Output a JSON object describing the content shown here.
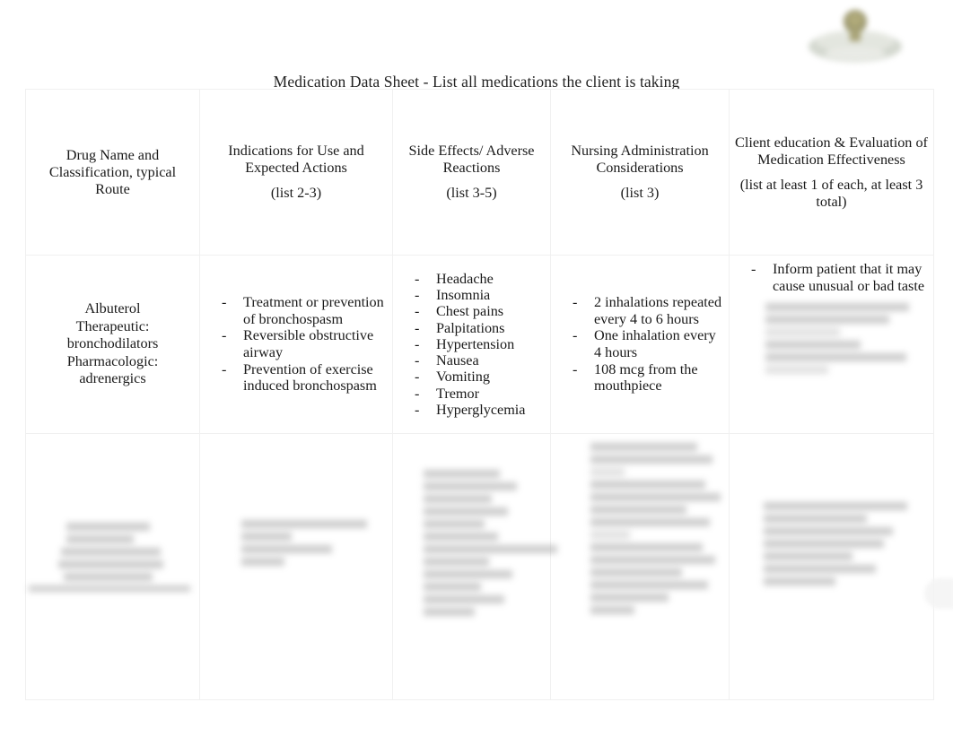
{
  "document": {
    "title": "Medication Data Sheet - List all medications the client is taking",
    "logo_icon": "school-crest-logo",
    "logo_colors": {
      "crest": "#8a8555",
      "banner": "#c9cec4"
    }
  },
  "table": {
    "columns": [
      {
        "id": "drug-name",
        "header_main": "Drug Name and Classification, typical Route",
        "header_sub": ""
      },
      {
        "id": "indications",
        "header_main": "Indications for Use and Expected Actions",
        "header_sub": "(list 2-3)"
      },
      {
        "id": "side-effects",
        "header_main": "Side Effects/ Adverse Reactions",
        "header_sub": "(list 3-5)"
      },
      {
        "id": "nursing-considerations",
        "header_main": "Nursing Administration Considerations",
        "header_sub": "(list 3)"
      },
      {
        "id": "client-education",
        "header_main": "Client education & Evaluation of Medication Effectiveness",
        "header_sub": "(list at least 1 of each, at least 3 total)"
      }
    ],
    "rows": [
      {
        "id": "albuterol-row",
        "drug_name": "Albuterol\nTherapeutic: bronchodilators\nPharmacologic: adrenergics",
        "drug_name_lines": [
          "Albuterol",
          "Therapeutic:",
          "bronchodilators",
          "Pharmacologic:",
          "adrenergics"
        ],
        "indications": [
          "Treatment or prevention of bronchospasm",
          "Reversible obstructive airway",
          "Prevention of exercise induced bronchospasm"
        ],
        "side_effects": [
          "Headache",
          "Insomnia",
          "Chest pains",
          "Palpitations",
          "Hypertension",
          "Nausea",
          "Vomiting",
          "Tremor",
          "Hyperglycemia"
        ],
        "nursing_considerations": [
          "2 inhalations repeated every 4 to 6 hours",
          "One inhalation every 4 hours",
          "108 mcg from the mouthpiece"
        ],
        "client_education": [
          "Inform patient that it may cause unusual or bad taste"
        ],
        "client_education_redacted": true
      },
      {
        "id": "redacted-row",
        "redacted": true,
        "note": "All cells in this row are blurred / illegible in the source image."
      }
    ]
  }
}
